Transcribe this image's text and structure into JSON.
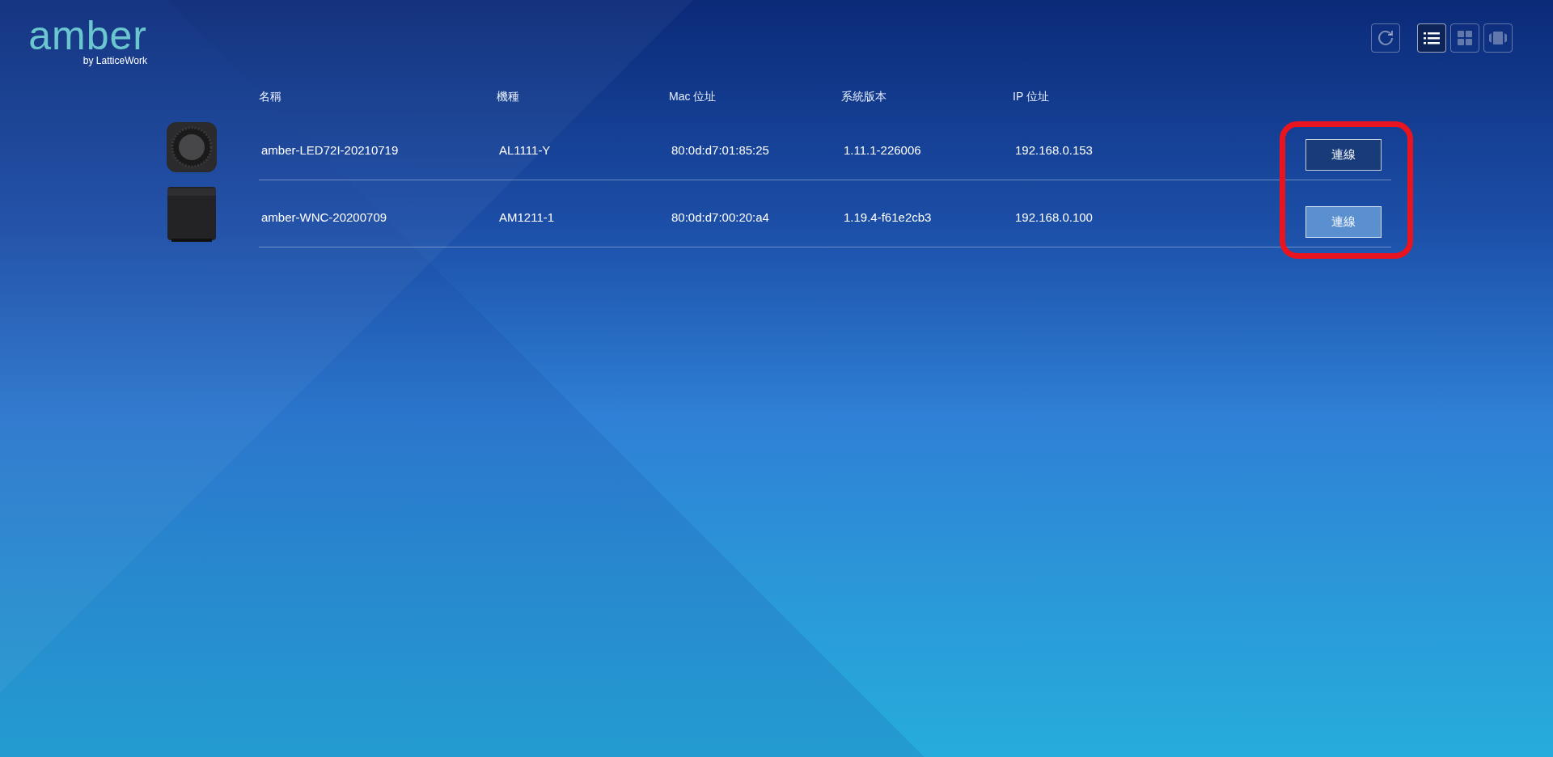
{
  "logo": {
    "wordmark": "amber",
    "tagline": "by LatticeWork"
  },
  "toolbar": {
    "refresh": {
      "kind": "refresh"
    },
    "views": [
      {
        "kind": "list",
        "selected": true
      },
      {
        "kind": "grid",
        "selected": false
      },
      {
        "kind": "carousel",
        "selected": false
      }
    ]
  },
  "table": {
    "columns": [
      "名稱",
      "機種",
      "Mac 位址",
      "系統版本",
      "IP 位址"
    ],
    "rows": [
      {
        "device": {
          "kind": "puck"
        },
        "name": "amber-LED72I-20210719",
        "model": "AL1111-Y",
        "mac": "80:0d:d7:01:85:25",
        "version": "1.11.1-226006",
        "ip": "192.168.0.153",
        "button": {
          "label": "連線",
          "hovered": true
        }
      },
      {
        "device": {
          "kind": "cube"
        },
        "name": "amber-WNC-20200709",
        "model": "AM1211-1",
        "mac": "80:0d:d7:00:20:a4",
        "version": "1.19.4-f61e2cb3",
        "ip": "192.168.0.100",
        "button": {
          "label": "連線",
          "hovered": false
        }
      }
    ],
    "highlight_frame": true
  }
}
